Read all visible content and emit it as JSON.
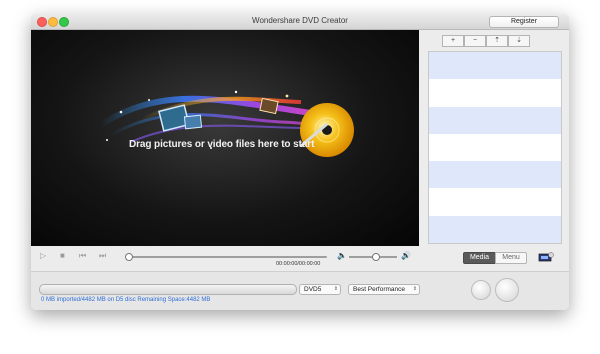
{
  "window": {
    "title": "Wondershare DVD Creator",
    "register_label": "Register"
  },
  "preview": {
    "drop_text": "Drag  pictures or video files here to start"
  },
  "toolbar": {
    "add_label": "+",
    "remove_label": "−",
    "up_label": "⇡",
    "down_label": "⇣"
  },
  "player": {
    "timecode": "00:00:00/00:00:00",
    "progress": 0,
    "volume": 0.55
  },
  "view_tabs": {
    "media_label": "Media",
    "menu_label": "Menu",
    "active": "Media"
  },
  "bottom": {
    "capacity_info": "0 MB imported/4482 MB on D5 disc    Remaining Space:4482 MB",
    "disc_type": "DVD5",
    "quality": "Best Performance"
  },
  "list": {
    "row_count": 7
  }
}
